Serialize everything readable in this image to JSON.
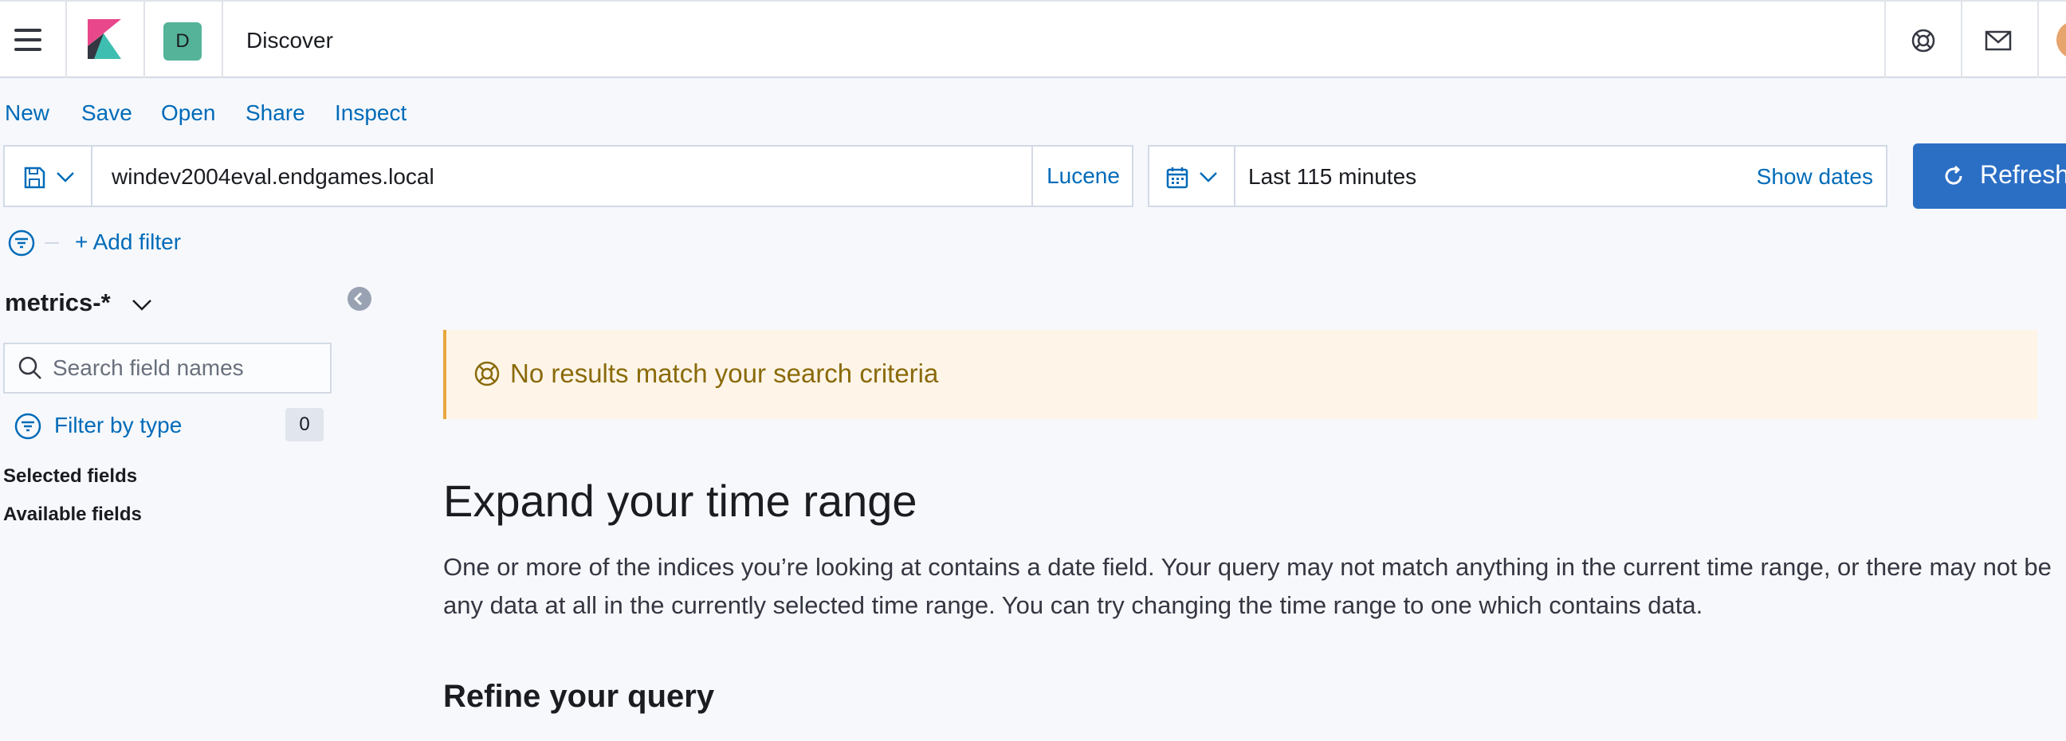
{
  "header": {
    "space_initial": "D",
    "page_title": "Discover"
  },
  "top_menu": {
    "new": "New",
    "save": "Save",
    "open": "Open",
    "share": "Share",
    "inspect": "Inspect"
  },
  "query": {
    "value": "windev2004eval.endgames.local",
    "language": "Lucene"
  },
  "date_picker": {
    "range": "Last 115 minutes",
    "show_dates": "Show dates"
  },
  "refresh_label": "Refresh",
  "filters": {
    "add_filter": "+ Add filter"
  },
  "sidebar": {
    "index_pattern": "metrics-*",
    "search_placeholder": "Search field names",
    "filter_by_type": "Filter by type",
    "filter_count": "0",
    "selected_fields": "Selected fields",
    "available_fields": "Available fields"
  },
  "main": {
    "callout": "No results match your search criteria",
    "expand_heading": "Expand your time range",
    "expand_body": "One or more of the indices you’re looking at contains a date field. Your query may not match anything in the current time range, or there may not be any data at all in the currently selected time range. You can try changing the time range to one which contains data.",
    "refine_heading": "Refine your query"
  },
  "colors": {
    "link": "#006bb8",
    "primary_button": "#2b6fc5",
    "space_badge": "#54b399",
    "callout_bg": "#fef5e8",
    "callout_border": "#e6a83e",
    "callout_text": "#8a6a0a"
  },
  "icons": {
    "menu": "hamburger-icon",
    "logo": "kibana-logo-icon",
    "help": "help-lifebuoy-icon",
    "news": "mail-icon",
    "saved_query": "save-disk-icon",
    "calendar": "calendar-icon",
    "refresh": "refresh-icon",
    "filter": "filter-icon",
    "search": "search-icon",
    "collapse": "collapse-arrow-icon",
    "callout": "help-lifebuoy-icon"
  }
}
